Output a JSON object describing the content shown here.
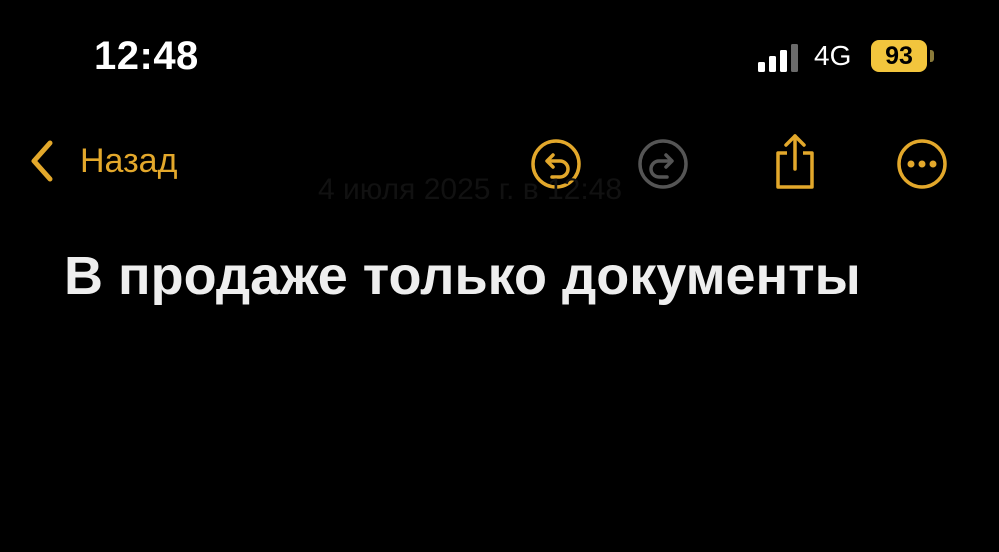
{
  "status_bar": {
    "time": "12:48",
    "network": "4G",
    "battery_level": "93"
  },
  "nav": {
    "back_label": "Назад",
    "icons": [
      "chevron-left-icon",
      "undo-icon",
      "redo-icon",
      "share-icon",
      "more-icon"
    ]
  },
  "note": {
    "date": "4 июля 2025 г. в 12:48",
    "title": "В продаже только документы"
  },
  "colors": {
    "accent": "#e3a82b",
    "battery": "#f2c53d",
    "background": "#000000",
    "text": "#eeeeee",
    "disabled_icon": "#555555"
  }
}
